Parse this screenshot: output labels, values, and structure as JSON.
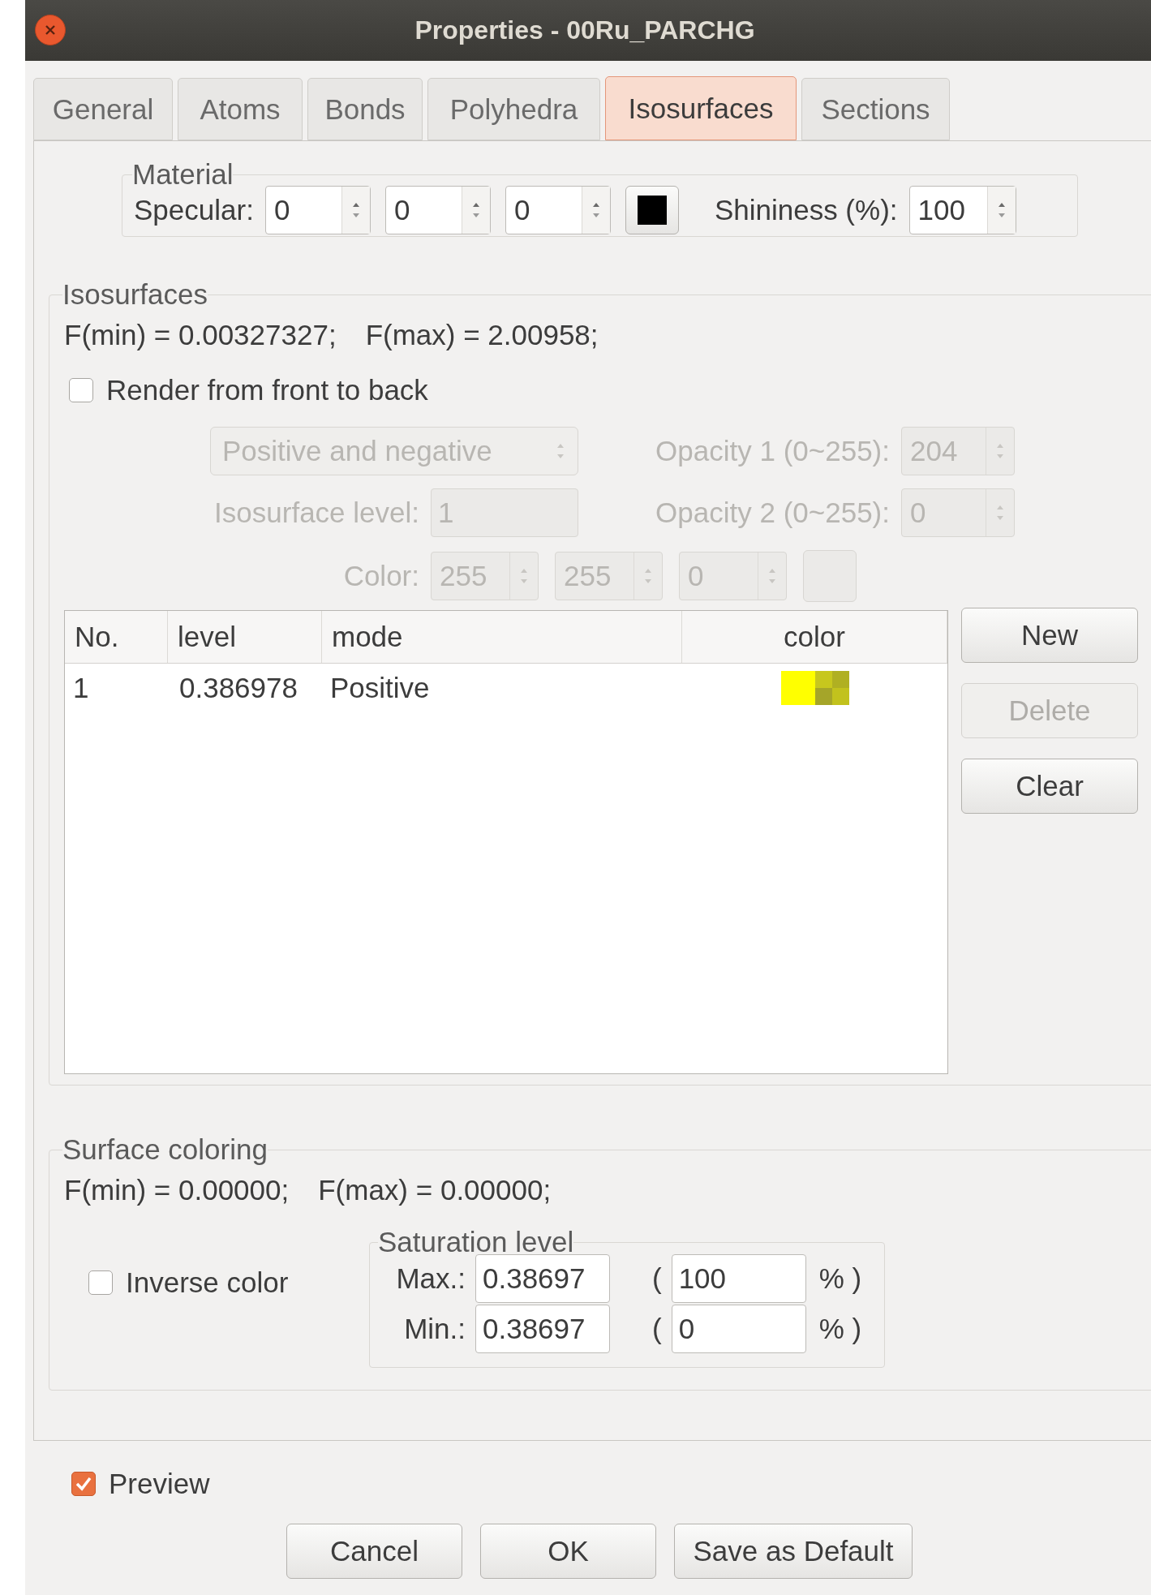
{
  "window": {
    "title": "Properties - 00Ru_PARCHG"
  },
  "tabs": [
    {
      "label": "General",
      "selected": false
    },
    {
      "label": "Atoms",
      "selected": false
    },
    {
      "label": "Bonds",
      "selected": false
    },
    {
      "label": "Polyhedra",
      "selected": false
    },
    {
      "label": "Isosurfaces",
      "selected": true
    },
    {
      "label": "Sections",
      "selected": false
    }
  ],
  "material": {
    "title": "Material",
    "specular_label": "Specular:",
    "specular": [
      "0",
      "0",
      "0"
    ],
    "swatch_filled": true,
    "shininess_label": "Shininess (%):",
    "shininess": "100"
  },
  "isosurfaces": {
    "title": "Isosurfaces",
    "fmin": "F(min) = 0.00327327;",
    "fmax": "F(max) = 2.00958;",
    "render_front_to_back": {
      "label": "Render from front to back",
      "checked": false
    },
    "settings": {
      "disabled": true,
      "mode": "Positive and negative",
      "opacity1_label": "Opacity 1 (0~255):",
      "opacity1": "204",
      "level_label": "Isosurface level:",
      "level_value": "1",
      "opacity2_label": "Opacity 2 (0~255):",
      "opacity2": "0",
      "color_label": "Color:",
      "rgb": [
        "255",
        "255",
        "0"
      ]
    },
    "table": {
      "columns": [
        "No.",
        "level",
        "mode",
        "color"
      ],
      "rows": [
        {
          "no": "1",
          "level": "0.386978",
          "mode": "Positive",
          "color": "#ffff00"
        }
      ]
    },
    "buttons": [
      {
        "label": "New",
        "disabled": false
      },
      {
        "label": "Delete",
        "disabled": true
      },
      {
        "label": "Clear",
        "disabled": false
      }
    ]
  },
  "surface_coloring": {
    "title": "Surface coloring",
    "fmin": "F(min) = 0.00000;",
    "fmax": "F(max) = 0.00000;",
    "inverse_color": {
      "label": "Inverse color",
      "checked": false
    },
    "saturation": {
      "title": "Saturation level",
      "rows": [
        {
          "label": "Max.:",
          "value": "0.38697",
          "open": "(",
          "percent": "100",
          "close": "% )"
        },
        {
          "label": "Min.:",
          "value": "0.38697",
          "open": "(",
          "percent": "0",
          "close": "% )"
        }
      ]
    }
  },
  "preview": {
    "label": "Preview",
    "checked": true
  },
  "dialog_buttons": [
    "Cancel",
    "OK",
    "Save as Default"
  ]
}
